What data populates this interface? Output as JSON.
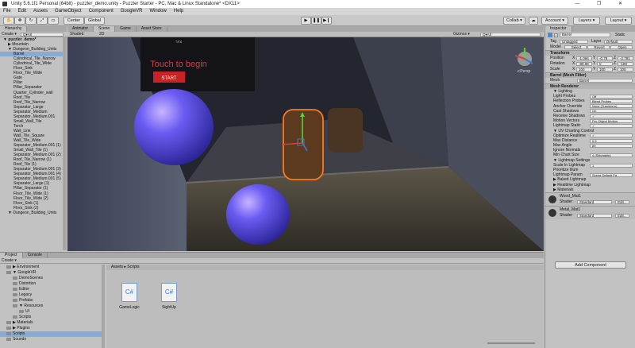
{
  "window": {
    "title": "Unity 5.6.1f1 Personal (64bit) - puzzler_demo.unity - Puzzler Starter - PC, Mac & Linux Standalone* <DX11>",
    "controls": "—  ❐  ✕"
  },
  "menu": [
    "File",
    "Edit",
    "Assets",
    "GameObject",
    "Component",
    "GoogleVR",
    "Window",
    "Help"
  ],
  "toolbar": {
    "center": "Center",
    "global": "Global",
    "collab": "Collab ▾",
    "account": "Account ▾",
    "layers": "Layers ▾",
    "layout": "Layout ▾"
  },
  "hierarchy": {
    "tab": "Hierarchy",
    "create": "Create ▾",
    "search": "Q▾All",
    "items": [
      {
        "t": "▼ puzzler_demo*",
        "k": "bold"
      },
      {
        "t": "▶ Mountain",
        "k": "d2"
      },
      {
        "t": "▼ Dungeon_Building_Units",
        "k": "d2"
      },
      {
        "t": "Barrel",
        "k": "sel"
      },
      {
        "t": "Cylindrical_Tile_Narrow"
      },
      {
        "t": "Cylindrical_Tile_Wide"
      },
      {
        "t": "Floor_Sink"
      },
      {
        "t": "Floor_Tile_Wide"
      },
      {
        "t": "Gate"
      },
      {
        "t": "Pillar"
      },
      {
        "t": "Pillar_Separator"
      },
      {
        "t": "Quarter_Cylinder_wall"
      },
      {
        "t": "Roof_Tile"
      },
      {
        "t": "Roof_Tile_Narrow"
      },
      {
        "t": "Separator_Large"
      },
      {
        "t": "Separator_Medium"
      },
      {
        "t": "Separator_Medium.001"
      },
      {
        "t": "Small_Wall_Tile"
      },
      {
        "t": "Torch"
      },
      {
        "t": "Wall_Link"
      },
      {
        "t": "Wall_Tile_Square"
      },
      {
        "t": "Wall_Tile_Wide"
      },
      {
        "t": "Separator_Medium.001 (1)"
      },
      {
        "t": "Small_Wall_Tile (1)"
      },
      {
        "t": "Separator_Medium.001 (2)"
      },
      {
        "t": "Roof_Tile_Narrow (1)"
      },
      {
        "t": "Roof_Tile (1)"
      },
      {
        "t": "Separator_Medium.001 (3)"
      },
      {
        "t": "Separator_Medium.001 (4)"
      },
      {
        "t": "Separator_Medium.001 (5)"
      },
      {
        "t": "Separator_Large (1)"
      },
      {
        "t": "Pillar_Separator (1)"
      },
      {
        "t": "Floor_Tile_Wide (1)"
      },
      {
        "t": "Floor_Tile_Wide (2)"
      },
      {
        "t": "Floor_Sink (1)"
      },
      {
        "t": "Floor_Sink (2)"
      },
      {
        "t": "▼ Dungeon_Building_Units",
        "k": "d2"
      }
    ]
  },
  "scene": {
    "tabs": [
      "Animator",
      "Scene",
      "Game",
      "Asset Store"
    ],
    "shaded": "Shaded",
    "mode": "2D",
    "gizmos": "Gizmos ▾",
    "search": "Q▾All",
    "persp": "≺Persp",
    "sign_title": "Touch to begin",
    "sign_button": "START",
    "sign_top": "ציור"
  },
  "inspector": {
    "tab": "Inspector",
    "name": "Barrel",
    "static": "Static",
    "tag": "Tag",
    "tag_val": "Untagged",
    "layer": "Layer",
    "layer_val": "Default",
    "model": "Model",
    "model_btns": [
      "Select",
      "Revert",
      "Open"
    ],
    "transform": {
      "title": "Transform",
      "rows": [
        {
          "l": "Position",
          "x": "-1.094",
          "y": "-0.78",
          "z": "-2.791"
        },
        {
          "l": "Rotation",
          "x": "-89.98",
          "y": "0",
          "z": "-180"
        },
        {
          "l": "Scale",
          "x": "100",
          "y": "100",
          "z": "100"
        }
      ]
    },
    "mesh_filter": {
      "title": "Barrel (Mesh Filter)",
      "mesh": "Mesh",
      "mesh_val": "Barrel"
    },
    "mesh_renderer": {
      "title": "Mesh Renderer",
      "props": [
        {
          "l": "▼ Lighting",
          "v": ""
        },
        {
          "l": "Light Probes",
          "v": "Off"
        },
        {
          "l": "Reflection Probes",
          "v": "Blend Probes"
        },
        {
          "l": "Anchor Override",
          "v": "None (Transform)"
        },
        {
          "l": "Cast Shadows",
          "v": "On"
        },
        {
          "l": "Receive Shadows",
          "v": "✓"
        },
        {
          "l": "Motion Vectors",
          "v": "Per Object Motion"
        },
        {
          "l": "Lightmap Static",
          "v": "✓"
        },
        {
          "l": "▼ UV Charting Control",
          "v": ""
        },
        {
          "l": "Optimize Realtime",
          "v": "✓"
        },
        {
          "l": "Max Distance",
          "v": "0.5"
        },
        {
          "l": "Max Angle",
          "v": "89"
        },
        {
          "l": "Ignore Normals",
          "v": ""
        },
        {
          "l": "Min Chart Size",
          "v": "4 (Stitchable)"
        },
        {
          "l": "▼ Lightmap Settings",
          "v": ""
        },
        {
          "l": "Scale In Lightmap",
          "v": "1"
        },
        {
          "l": "Prioritize Illum",
          "v": ""
        },
        {
          "l": "Lightmap Param",
          "v": "Scene Default Pa"
        },
        {
          "l": "▶ Baked Lightmap",
          "v": ""
        },
        {
          "l": "▶ Realtime Lightmap",
          "v": ""
        },
        {
          "l": "▶ Materials",
          "v": ""
        }
      ]
    },
    "materials": [
      {
        "name": "Wood_Mat1",
        "shader": "Shader",
        "shader_val": "Standard"
      },
      {
        "name": "Metal_Mat1",
        "shader": "Shader",
        "shader_val": "Standard"
      }
    ],
    "add_component": "Add Component"
  },
  "project": {
    "tabs": [
      "Project",
      "Console"
    ],
    "create": "Create ▾",
    "tree": [
      {
        "t": "▶ Environment"
      },
      {
        "t": "▼ GoogleVR"
      },
      {
        "t": "DemoScenes",
        "d": 1
      },
      {
        "t": "Distortion",
        "d": 1
      },
      {
        "t": "Editor",
        "d": 1
      },
      {
        "t": "Legacy",
        "d": 1
      },
      {
        "t": "Prefabs",
        "d": 1
      },
      {
        "t": "▼ Resources",
        "d": 1
      },
      {
        "t": "UI",
        "d": 2
      },
      {
        "t": "Scripts",
        "d": 1
      },
      {
        "t": "▶ Materials"
      },
      {
        "t": "▶ Plugins"
      },
      {
        "t": "Scripts",
        "sel": true
      },
      {
        "t": "Sounds"
      }
    ],
    "breadcrumb": "Assets ▸ Scripts",
    "files": [
      {
        "name": "GameLogic"
      },
      {
        "name": "SightUp"
      }
    ],
    "file_icon": "C#"
  },
  "colors": {
    "accent": "#3b7bd6",
    "selection": "#8aaad6",
    "scene_bg": "#2a2c36"
  }
}
